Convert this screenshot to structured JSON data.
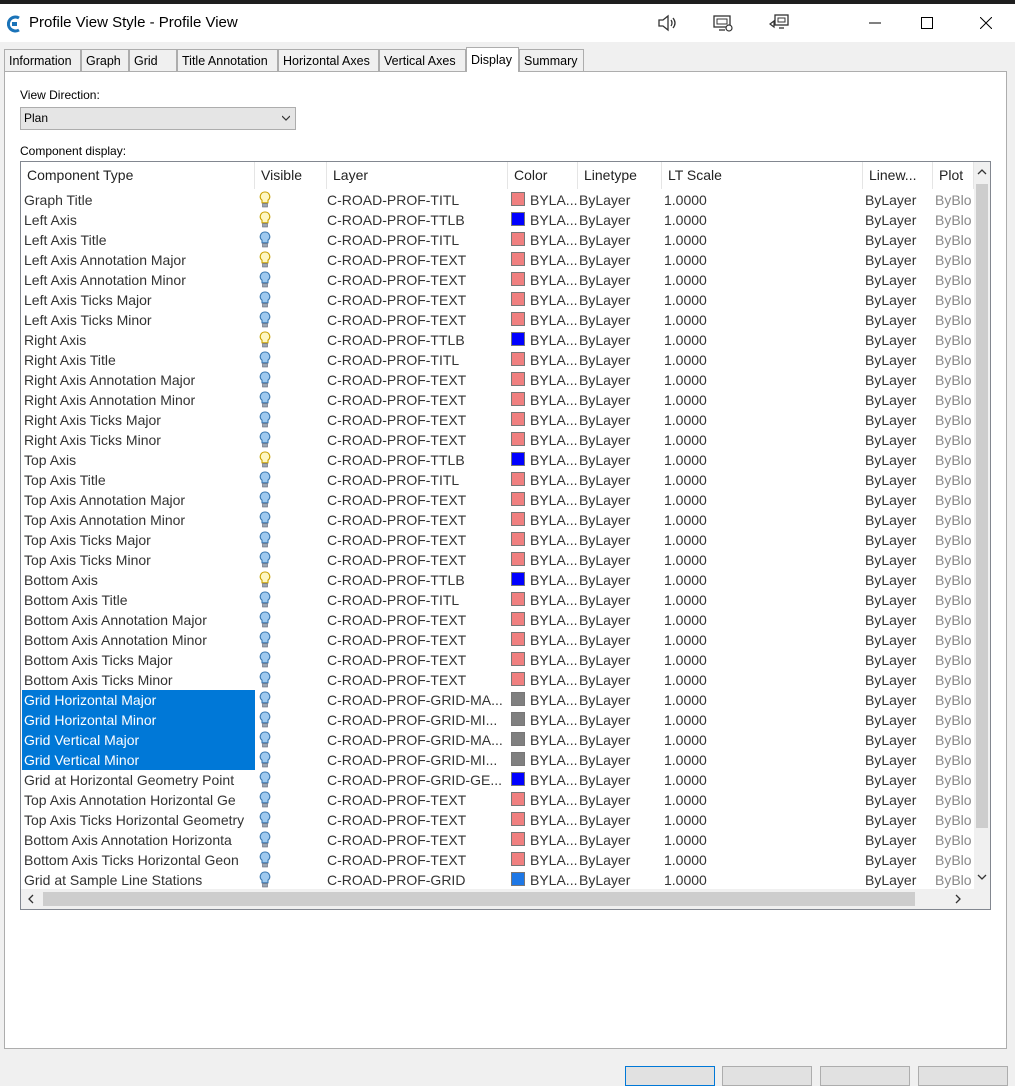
{
  "window": {
    "title": "Profile View Style - Profile View"
  },
  "colors": {
    "red": "#f08080",
    "blue": "#0000ff",
    "gray": "#808080",
    "lightblue": "#1e78e6",
    "selection": "#0078d7"
  },
  "tabs": [
    "Information",
    "Graph",
    "Grid",
    "Title Annotation",
    "Horizontal Axes",
    "Vertical Axes",
    "Display",
    "Summary"
  ],
  "view_direction": {
    "label": "View Direction:",
    "value": "Plan"
  },
  "component_display": {
    "label": "Component display:"
  },
  "columns": [
    "Component Type",
    "Visible",
    "Layer",
    "Color",
    "Linetype",
    "LT Scale",
    "Linew...",
    "Plot"
  ],
  "rows": [
    {
      "name": "Graph Title",
      "vis": "on",
      "layer": "C-ROAD-PROF-TITL",
      "swatch": "red",
      "color": "BYLA...",
      "linetype": "ByLayer",
      "lts": "1.0000",
      "lw": "ByLayer",
      "plot": "ByBlo"
    },
    {
      "name": "Left Axis",
      "vis": "on",
      "layer": "C-ROAD-PROF-TTLB",
      "swatch": "blue",
      "color": "BYLA...",
      "linetype": "ByLayer",
      "lts": "1.0000",
      "lw": "ByLayer",
      "plot": "ByBlo"
    },
    {
      "name": "Left Axis Title",
      "vis": "off",
      "layer": "C-ROAD-PROF-TITL",
      "swatch": "red",
      "color": "BYLA...",
      "linetype": "ByLayer",
      "lts": "1.0000",
      "lw": "ByLayer",
      "plot": "ByBlo"
    },
    {
      "name": "Left Axis Annotation Major",
      "vis": "on",
      "layer": "C-ROAD-PROF-TEXT",
      "swatch": "red",
      "color": "BYLA...",
      "linetype": "ByLayer",
      "lts": "1.0000",
      "lw": "ByLayer",
      "plot": "ByBlo"
    },
    {
      "name": "Left Axis Annotation Minor",
      "vis": "off",
      "layer": "C-ROAD-PROF-TEXT",
      "swatch": "red",
      "color": "BYLA...",
      "linetype": "ByLayer",
      "lts": "1.0000",
      "lw": "ByLayer",
      "plot": "ByBlo"
    },
    {
      "name": "Left Axis Ticks Major",
      "vis": "off",
      "layer": "C-ROAD-PROF-TEXT",
      "swatch": "red",
      "color": "BYLA...",
      "linetype": "ByLayer",
      "lts": "1.0000",
      "lw": "ByLayer",
      "plot": "ByBlo"
    },
    {
      "name": "Left Axis Ticks Minor",
      "vis": "off",
      "layer": "C-ROAD-PROF-TEXT",
      "swatch": "red",
      "color": "BYLA...",
      "linetype": "ByLayer",
      "lts": "1.0000",
      "lw": "ByLayer",
      "plot": "ByBlo"
    },
    {
      "name": "Right Axis",
      "vis": "on",
      "layer": "C-ROAD-PROF-TTLB",
      "swatch": "blue",
      "color": "BYLA...",
      "linetype": "ByLayer",
      "lts": "1.0000",
      "lw": "ByLayer",
      "plot": "ByBlo"
    },
    {
      "name": "Right Axis Title",
      "vis": "off",
      "layer": "C-ROAD-PROF-TITL",
      "swatch": "red",
      "color": "BYLA...",
      "linetype": "ByLayer",
      "lts": "1.0000",
      "lw": "ByLayer",
      "plot": "ByBlo"
    },
    {
      "name": "Right Axis Annotation Major",
      "vis": "off",
      "layer": "C-ROAD-PROF-TEXT",
      "swatch": "red",
      "color": "BYLA...",
      "linetype": "ByLayer",
      "lts": "1.0000",
      "lw": "ByLayer",
      "plot": "ByBlo"
    },
    {
      "name": "Right Axis Annotation Minor",
      "vis": "off",
      "layer": "C-ROAD-PROF-TEXT",
      "swatch": "red",
      "color": "BYLA...",
      "linetype": "ByLayer",
      "lts": "1.0000",
      "lw": "ByLayer",
      "plot": "ByBlo"
    },
    {
      "name": "Right Axis Ticks Major",
      "vis": "off",
      "layer": "C-ROAD-PROF-TEXT",
      "swatch": "red",
      "color": "BYLA...",
      "linetype": "ByLayer",
      "lts": "1.0000",
      "lw": "ByLayer",
      "plot": "ByBlo"
    },
    {
      "name": "Right Axis Ticks Minor",
      "vis": "off",
      "layer": "C-ROAD-PROF-TEXT",
      "swatch": "red",
      "color": "BYLA...",
      "linetype": "ByLayer",
      "lts": "1.0000",
      "lw": "ByLayer",
      "plot": "ByBlo"
    },
    {
      "name": "Top Axis",
      "vis": "on",
      "layer": "C-ROAD-PROF-TTLB",
      "swatch": "blue",
      "color": "BYLA...",
      "linetype": "ByLayer",
      "lts": "1.0000",
      "lw": "ByLayer",
      "plot": "ByBlo"
    },
    {
      "name": "Top Axis Title",
      "vis": "off",
      "layer": "C-ROAD-PROF-TITL",
      "swatch": "red",
      "color": "BYLA...",
      "linetype": "ByLayer",
      "lts": "1.0000",
      "lw": "ByLayer",
      "plot": "ByBlo"
    },
    {
      "name": "Top Axis Annotation Major",
      "vis": "off",
      "layer": "C-ROAD-PROF-TEXT",
      "swatch": "red",
      "color": "BYLA...",
      "linetype": "ByLayer",
      "lts": "1.0000",
      "lw": "ByLayer",
      "plot": "ByBlo"
    },
    {
      "name": "Top Axis Annotation Minor",
      "vis": "off",
      "layer": "C-ROAD-PROF-TEXT",
      "swatch": "red",
      "color": "BYLA...",
      "linetype": "ByLayer",
      "lts": "1.0000",
      "lw": "ByLayer",
      "plot": "ByBlo"
    },
    {
      "name": "Top Axis Ticks Major",
      "vis": "off",
      "layer": "C-ROAD-PROF-TEXT",
      "swatch": "red",
      "color": "BYLA...",
      "linetype": "ByLayer",
      "lts": "1.0000",
      "lw": "ByLayer",
      "plot": "ByBlo"
    },
    {
      "name": "Top Axis Ticks Minor",
      "vis": "off",
      "layer": "C-ROAD-PROF-TEXT",
      "swatch": "red",
      "color": "BYLA...",
      "linetype": "ByLayer",
      "lts": "1.0000",
      "lw": "ByLayer",
      "plot": "ByBlo"
    },
    {
      "name": "Bottom Axis",
      "vis": "on",
      "layer": "C-ROAD-PROF-TTLB",
      "swatch": "blue",
      "color": "BYLA...",
      "linetype": "ByLayer",
      "lts": "1.0000",
      "lw": "ByLayer",
      "plot": "ByBlo"
    },
    {
      "name": "Bottom Axis Title",
      "vis": "off",
      "layer": "C-ROAD-PROF-TITL",
      "swatch": "red",
      "color": "BYLA...",
      "linetype": "ByLayer",
      "lts": "1.0000",
      "lw": "ByLayer",
      "plot": "ByBlo"
    },
    {
      "name": "Bottom Axis Annotation Major",
      "vis": "off",
      "layer": "C-ROAD-PROF-TEXT",
      "swatch": "red",
      "color": "BYLA...",
      "linetype": "ByLayer",
      "lts": "1.0000",
      "lw": "ByLayer",
      "plot": "ByBlo"
    },
    {
      "name": "Bottom Axis Annotation Minor",
      "vis": "off",
      "layer": "C-ROAD-PROF-TEXT",
      "swatch": "red",
      "color": "BYLA...",
      "linetype": "ByLayer",
      "lts": "1.0000",
      "lw": "ByLayer",
      "plot": "ByBlo"
    },
    {
      "name": "Bottom Axis Ticks Major",
      "vis": "off",
      "layer": "C-ROAD-PROF-TEXT",
      "swatch": "red",
      "color": "BYLA...",
      "linetype": "ByLayer",
      "lts": "1.0000",
      "lw": "ByLayer",
      "plot": "ByBlo"
    },
    {
      "name": "Bottom Axis Ticks Minor",
      "vis": "off",
      "layer": "C-ROAD-PROF-TEXT",
      "swatch": "red",
      "color": "BYLA...",
      "linetype": "ByLayer",
      "lts": "1.0000",
      "lw": "ByLayer",
      "plot": "ByBlo"
    },
    {
      "name": "Grid Horizontal Major",
      "vis": "off",
      "layer": "C-ROAD-PROF-GRID-MA...",
      "swatch": "gray",
      "color": "BYLA...",
      "linetype": "ByLayer",
      "lts": "1.0000",
      "lw": "ByLayer",
      "plot": "ByBlo",
      "selected": true
    },
    {
      "name": "Grid Horizontal Minor",
      "vis": "off",
      "layer": "C-ROAD-PROF-GRID-MI...",
      "swatch": "gray",
      "color": "BYLA...",
      "linetype": "ByLayer",
      "lts": "1.0000",
      "lw": "ByLayer",
      "plot": "ByBlo",
      "selected": true
    },
    {
      "name": "Grid Vertical Major",
      "vis": "off",
      "layer": "C-ROAD-PROF-GRID-MA...",
      "swatch": "gray",
      "color": "BYLA...",
      "linetype": "ByLayer",
      "lts": "1.0000",
      "lw": "ByLayer",
      "plot": "ByBlo",
      "selected": true
    },
    {
      "name": "Grid Vertical Minor",
      "vis": "off",
      "layer": "C-ROAD-PROF-GRID-MI...",
      "swatch": "gray",
      "color": "BYLA...",
      "linetype": "ByLayer",
      "lts": "1.0000",
      "lw": "ByLayer",
      "plot": "ByBlo",
      "selected": true
    },
    {
      "name": "Grid at Horizontal Geometry Point",
      "vis": "off",
      "layer": "C-ROAD-PROF-GRID-GE...",
      "swatch": "blue",
      "color": "BYLA...",
      "linetype": "ByLayer",
      "lts": "1.0000",
      "lw": "ByLayer",
      "plot": "ByBlo"
    },
    {
      "name": "Top Axis Annotation Horizontal Ge",
      "vis": "off",
      "layer": "C-ROAD-PROF-TEXT",
      "swatch": "red",
      "color": "BYLA...",
      "linetype": "ByLayer",
      "lts": "1.0000",
      "lw": "ByLayer",
      "plot": "ByBlo"
    },
    {
      "name": "Top Axis Ticks Horizontal Geometry",
      "vis": "off",
      "layer": "C-ROAD-PROF-TEXT",
      "swatch": "red",
      "color": "BYLA...",
      "linetype": "ByLayer",
      "lts": "1.0000",
      "lw": "ByLayer",
      "plot": "ByBlo"
    },
    {
      "name": "Bottom Axis Annotation Horizonta",
      "vis": "off",
      "layer": "C-ROAD-PROF-TEXT",
      "swatch": "red",
      "color": "BYLA...",
      "linetype": "ByLayer",
      "lts": "1.0000",
      "lw": "ByLayer",
      "plot": "ByBlo"
    },
    {
      "name": "Bottom Axis Ticks Horizontal Geon",
      "vis": "off",
      "layer": "C-ROAD-PROF-TEXT",
      "swatch": "red",
      "color": "BYLA...",
      "linetype": "ByLayer",
      "lts": "1.0000",
      "lw": "ByLayer",
      "plot": "ByBlo"
    },
    {
      "name": "Grid at Sample Line Stations",
      "vis": "off",
      "layer": "C-ROAD-PROF-GRID",
      "swatch": "lightblue",
      "color": "BYLA...",
      "linetype": "ByLayer",
      "lts": "1.0000",
      "lw": "ByLayer",
      "plot": "ByBlo"
    }
  ]
}
